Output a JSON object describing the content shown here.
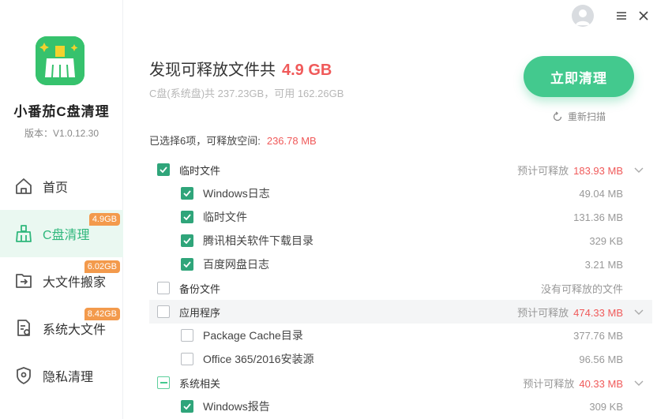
{
  "sidebar": {
    "app_name": "小番茄C盘清理",
    "version": "版本：V1.0.12.30",
    "items": [
      {
        "label": "首页",
        "icon": "home-icon",
        "badge": ""
      },
      {
        "label": "C盘清理",
        "icon": "broom-icon",
        "badge": "4.9GB"
      },
      {
        "label": "大文件搬家",
        "icon": "move-files-icon",
        "badge": "6.02GB"
      },
      {
        "label": "系统大文件",
        "icon": "system-files-icon",
        "badge": "8.42GB"
      },
      {
        "label": "隐私清理",
        "icon": "shield-icon",
        "badge": ""
      }
    ]
  },
  "header": {
    "found_prefix": "发现可释放文件共",
    "found_size": "4.9 GB",
    "disk_info": "C盘(系统盘)共 237.23GB，可用 162.26GB",
    "clean_button": "立即清理",
    "rescan": "重新扫描",
    "selected_prefix": "已选择6项，可释放空间:",
    "selected_size": "236.78 MB"
  },
  "list": [
    {
      "label": "临时文件",
      "level": "parent",
      "state": "checked",
      "right_text": "预计可释放",
      "amount": "183.93 MB",
      "expand": true
    },
    {
      "label": "Windows日志",
      "level": "child",
      "state": "checked",
      "size": "49.04 MB"
    },
    {
      "label": "临时文件",
      "level": "child",
      "state": "checked",
      "size": "131.36 MB"
    },
    {
      "label": "腾讯相关软件下载目录",
      "level": "child",
      "state": "checked",
      "size": "329 KB"
    },
    {
      "label": "百度网盘日志",
      "level": "child",
      "state": "checked",
      "size": "3.21 MB"
    },
    {
      "label": "备份文件",
      "level": "parent",
      "state": "unchecked",
      "right_text": "没有可释放的文件"
    },
    {
      "label": "应用程序",
      "level": "parent",
      "state": "unchecked",
      "right_text": "预计可释放",
      "amount": "474.33 MB",
      "expand": true,
      "highlight": true
    },
    {
      "label": "Package Cache目录",
      "level": "child",
      "state": "unchecked",
      "size": "377.76 MB"
    },
    {
      "label": "Office 365/2016安装源",
      "level": "child",
      "state": "unchecked",
      "size": "96.56 MB"
    },
    {
      "label": "系统相关",
      "level": "parent",
      "state": "partial",
      "right_text": "预计可释放",
      "amount": "40.33 MB",
      "expand": true
    },
    {
      "label": "Windows报告",
      "level": "child",
      "state": "checked",
      "size": "309 KB"
    }
  ],
  "colors": {
    "accent": "#43c98e",
    "checked": "#2fa57a",
    "amount_red": "#f05a5a",
    "badge_orange": "#f39a4c",
    "active_bg": "#eaf8f1"
  }
}
